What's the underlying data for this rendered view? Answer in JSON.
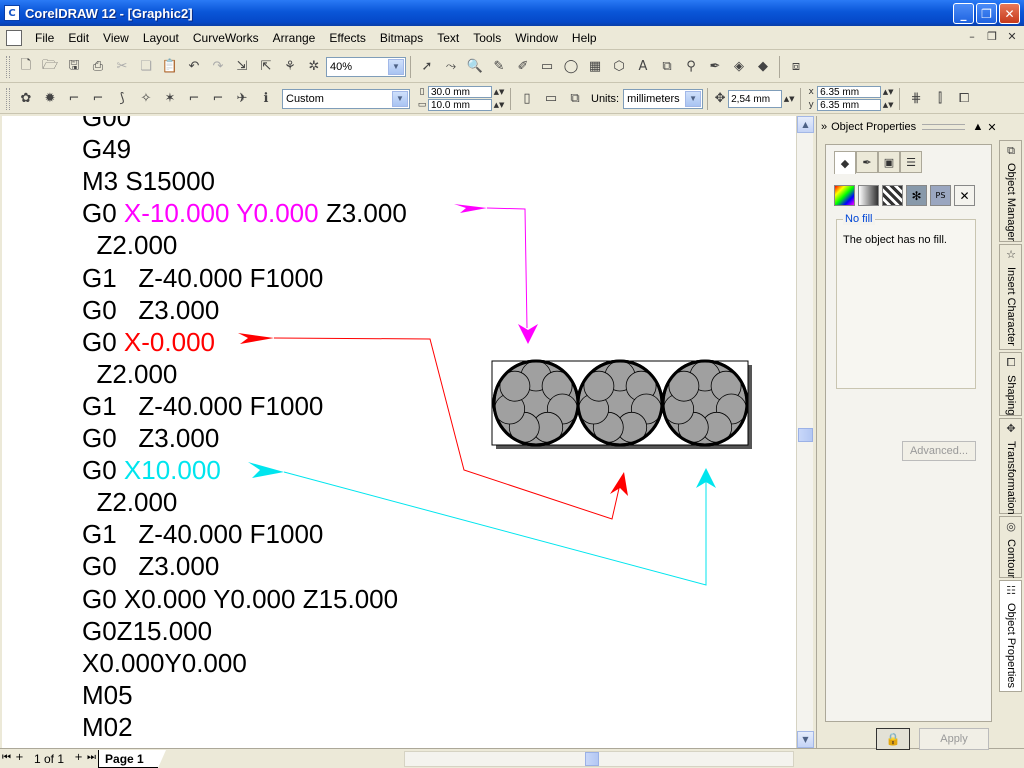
{
  "window": {
    "title": "CorelDRAW 12 - [Graphic2]"
  },
  "menu": [
    "File",
    "Edit",
    "View",
    "Layout",
    "CurveWorks",
    "Arrange",
    "Effects",
    "Bitmaps",
    "Text",
    "Tools",
    "Window",
    "Help"
  ],
  "toolbar": {
    "zoom": "40%"
  },
  "property_bar": {
    "paper_preset": "Custom",
    "width": "30.0 mm",
    "height": "10.0 mm",
    "units_label": "Units:",
    "units": "millimeters",
    "nudge": "2,54 mm",
    "dup_x": "6.35 mm",
    "dup_y": "6.35 mm"
  },
  "canvas": {
    "code_lines": [
      {
        "parts": [
          {
            "t": "G00",
            "c": ""
          }
        ]
      },
      {
        "parts": [
          {
            "t": "G49",
            "c": ""
          }
        ]
      },
      {
        "parts": [
          {
            "t": "M3 S15000",
            "c": ""
          }
        ]
      },
      {
        "parts": [
          {
            "t": "G0 ",
            "c": ""
          },
          {
            "t": "X-10.000 Y0.000",
            "c": "mag"
          },
          {
            "t": " Z3.000",
            "c": ""
          }
        ]
      },
      {
        "parts": [
          {
            "t": "  Z2.000",
            "c": ""
          }
        ]
      },
      {
        "parts": [
          {
            "t": "G1   Z-40.000 F1000",
            "c": ""
          }
        ]
      },
      {
        "parts": [
          {
            "t": "G0   Z3.000",
            "c": ""
          }
        ]
      },
      {
        "parts": [
          {
            "t": "G0 ",
            "c": ""
          },
          {
            "t": "X-0.000",
            "c": "red"
          }
        ]
      },
      {
        "parts": [
          {
            "t": "  Z2.000",
            "c": ""
          }
        ]
      },
      {
        "parts": [
          {
            "t": "G1   Z-40.000 F1000",
            "c": ""
          }
        ]
      },
      {
        "parts": [
          {
            "t": "G0   Z3.000",
            "c": ""
          }
        ]
      },
      {
        "parts": [
          {
            "t": "G0 ",
            "c": ""
          },
          {
            "t": "X10.000",
            "c": "cyan"
          }
        ]
      },
      {
        "parts": [
          {
            "t": "  Z2.000",
            "c": ""
          }
        ]
      },
      {
        "parts": [
          {
            "t": "G1   Z-40.000 F1000",
            "c": ""
          }
        ]
      },
      {
        "parts": [
          {
            "t": "G0   Z3.000",
            "c": ""
          }
        ]
      },
      {
        "parts": [
          {
            "t": "G0 X0.000 Y0.000 Z15.000",
            "c": ""
          }
        ]
      },
      {
        "parts": [
          {
            "t": "G0Z15.000",
            "c": ""
          }
        ]
      },
      {
        "parts": [
          {
            "t": "X0.000Y0.000",
            "c": ""
          }
        ]
      },
      {
        "parts": [
          {
            "t": "M05",
            "c": ""
          }
        ]
      },
      {
        "parts": [
          {
            "t": "M02",
            "c": ""
          }
        ]
      },
      {
        "parts": [
          {
            "t": "%",
            "c": ""
          }
        ]
      }
    ],
    "colors": {
      "magenta": "#ff00ff",
      "red": "#ff0000",
      "cyan": "#00e5ee",
      "circle_fill": "#a0a0a0"
    }
  },
  "pager": {
    "count": "1 of 1",
    "tab": "Page 1"
  },
  "docker": {
    "title": "Object Properties",
    "fill_group": "No fill",
    "fill_message": "The object has no fill.",
    "advanced": "Advanced...",
    "apply": "Apply"
  },
  "side_tabs": [
    "Object Manager",
    "Insert Character",
    "Shaping",
    "Transformation",
    "Contour",
    "Object Properties"
  ]
}
